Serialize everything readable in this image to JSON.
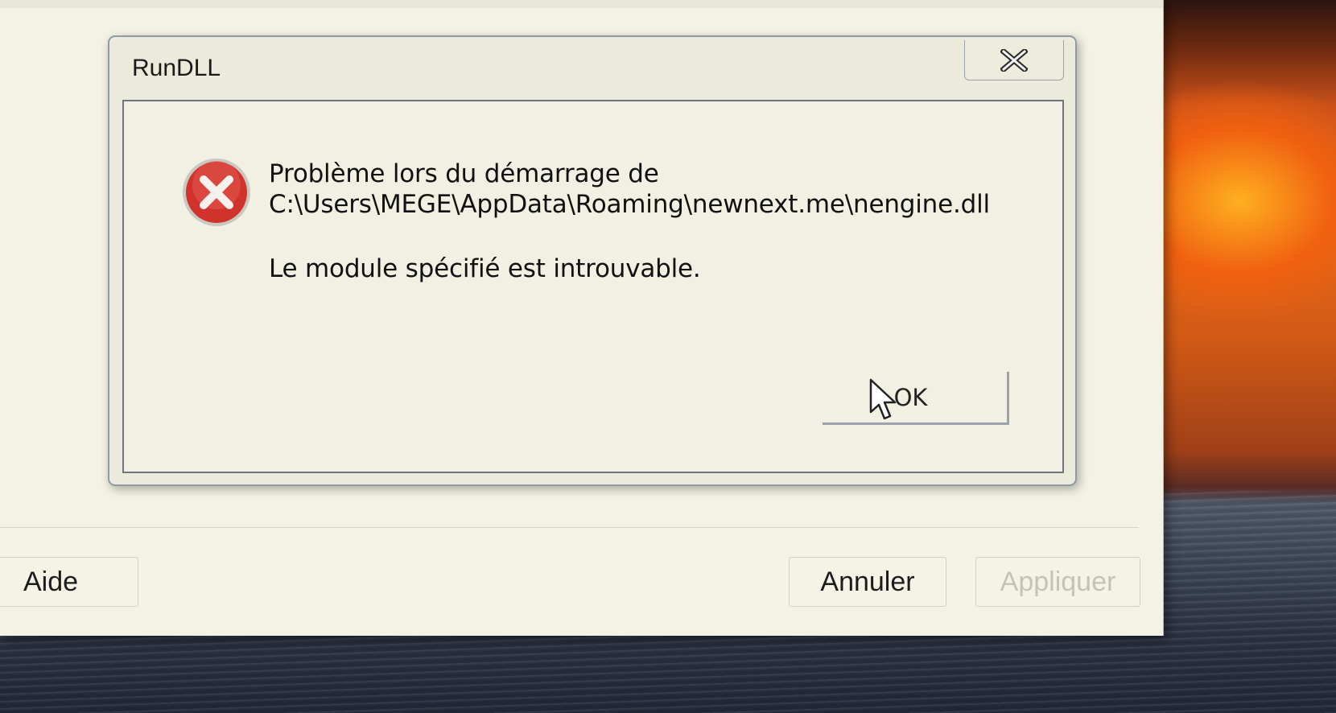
{
  "dialog": {
    "title": "RunDLL",
    "close_icon": "close-x-icon",
    "icon": "error-icon",
    "message_line1": "Problème lors du démarrage de",
    "message_line2": "C:\\Users\\MEGE\\AppData\\Roaming\\newnext.me\\nengine.dll",
    "message_line3": "Le module spécifié est introuvable.",
    "ok_label": "OK"
  },
  "background_window": {
    "help_label": "Aide",
    "cancel_label": "Annuler",
    "apply_label": "Appliquer"
  },
  "colors": {
    "error_red": "#d0332c",
    "dialog_bg": "#eceadb",
    "window_bg": "#f3f2e4",
    "disabled_text": "#c4c3b6"
  }
}
